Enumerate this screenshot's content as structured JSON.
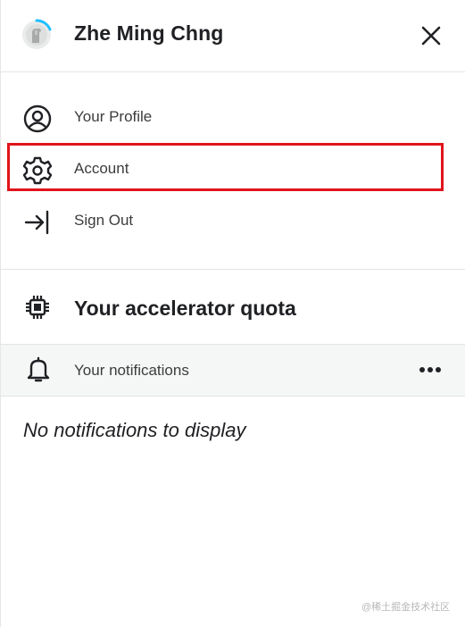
{
  "header": {
    "user_name": "Zhe Ming Chng",
    "avatar_icon": "user-avatar-icon",
    "close_icon": "close-icon"
  },
  "menu": {
    "items": [
      {
        "label": "Your Profile",
        "icon": "user-circle-icon"
      },
      {
        "label": "Account",
        "icon": "gear-icon",
        "highlighted": true
      },
      {
        "label": "Sign Out",
        "icon": "sign-out-icon"
      }
    ]
  },
  "quota": {
    "label": "Your accelerator quota",
    "icon": "chip-icon"
  },
  "notifications": {
    "label": "Your notifications",
    "icon": "bell-icon",
    "more_icon": "more-horizontal-icon",
    "empty_message": "No notifications to display"
  },
  "watermark": "@稀土掘金技术社区",
  "colors": {
    "highlight_border": "#e1141b",
    "avatar_ring": "#20beff",
    "notif_bar_bg": "#f5f7f6"
  }
}
